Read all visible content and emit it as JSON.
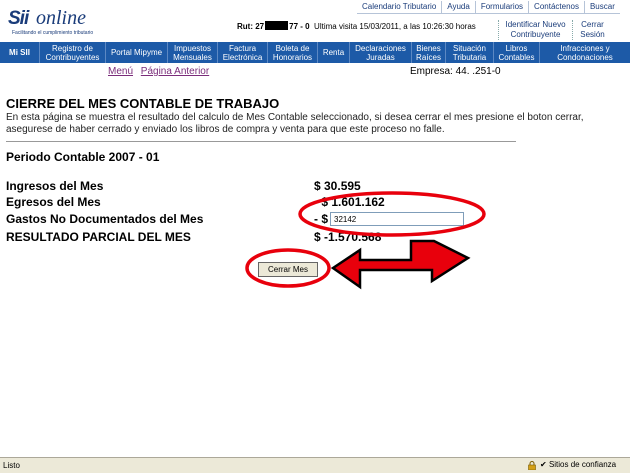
{
  "logo": {
    "sii": "Sii",
    "online": "online",
    "tagline": "Facilitando el cumplimiento tributario"
  },
  "toplinks": [
    "Calendario Tributario",
    "Ayuda",
    "Formularios",
    "Contáctenos",
    "Buscar"
  ],
  "session": {
    "rut_label": "Rut: 27",
    "rut_suffix": "77 - 0",
    "visit": "Ultima visita 15/03/2011, a las 10:26:30 horas"
  },
  "account_links": [
    "Identificar Nuevo Contribuyente",
    "Cerrar Sesión"
  ],
  "nav": [
    "Mi SII",
    "Registro de Contribuyentes",
    "Portal Mipyme",
    "Impuestos Mensuales",
    "Factura Electrónica",
    "Boleta de Honorarios",
    "Renta",
    "Declaraciones Juradas",
    "Bienes Raíces",
    "Situación Tributaria",
    "Libros Contables",
    "Infracciones y Condonaciones"
  ],
  "subnav": {
    "menu": "Menú",
    "prev": "Página Anterior"
  },
  "empresa": "Empresa: 44.    .251-0",
  "page": {
    "title": "CIERRE DEL MES CONTABLE DE TRABAJO",
    "description": "En esta página se muestra el resultado del calculo de Mes Contable seleccionado, si desea cerrar el mes presione el boton cerrar, asegurese de haber cerrado y enviado los libros de compra y venta para que este proceso no falle.",
    "periodo": "Periodo Contable 2007 - 01"
  },
  "summary": {
    "ingresos_label": "Ingresos del Mes",
    "ingresos_value": "$ 30.595",
    "egresos_label": "Egresos del Mes",
    "egresos_value": "- $ 1.601.162",
    "gastos_label": "Gastos No Documentados del Mes",
    "gastos_prefix": "- $",
    "gastos_value": "32142",
    "resultado_label": "RESULTADO PARCIAL DEL MES",
    "resultado_value": "$ -1.570.568"
  },
  "button": "Cerrar Mes",
  "statusbar": {
    "text": "Listo",
    "zone": "Sitios de confianza"
  },
  "colors": {
    "nav_bg": "#1d5aa7",
    "annotation": "#e8000c",
    "link": "#1a3c7a"
  }
}
